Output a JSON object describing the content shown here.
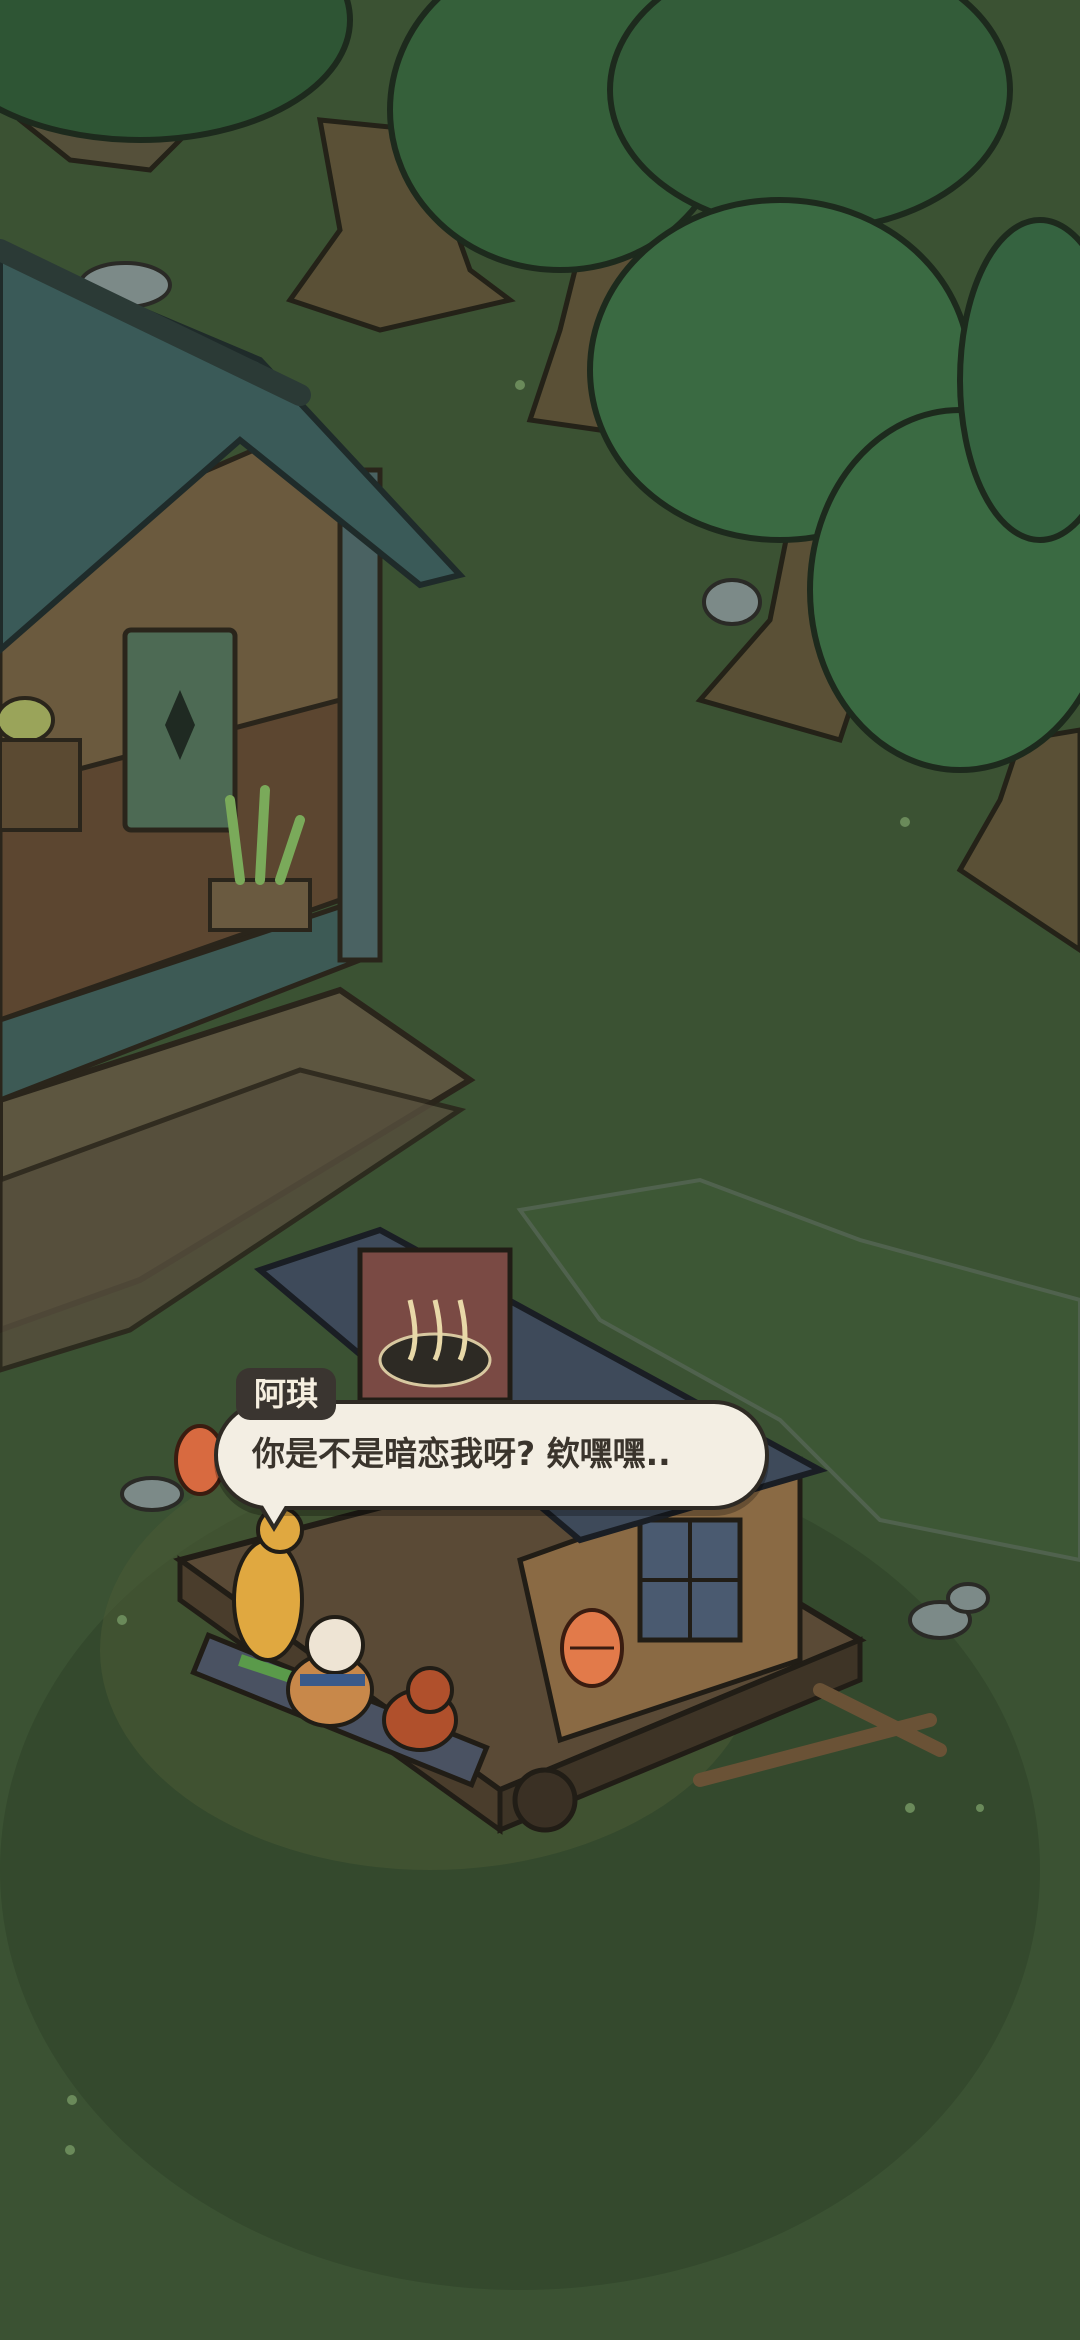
{
  "dialogue": {
    "speaker": "阿琪",
    "text": "你是不是暗恋我呀? 欸嘿嘿.."
  },
  "colors": {
    "grass": "#3b5233",
    "grass_dark": "#33472c",
    "tree_foliage": "#3a6a42",
    "tree_trunk": "#5a5036",
    "roof": "#3a5a58",
    "wood": "#6b5a3e",
    "lantern": "#e27a4a",
    "bubble": "#f3eee3",
    "tag": "#3a3530"
  },
  "icons": [
    "kettle-icon",
    "potted-plant-icon",
    "lantern-icon",
    "noodle-bowl-sign-icon",
    "giraffe-character",
    "hamster-character",
    "fox-character"
  ]
}
